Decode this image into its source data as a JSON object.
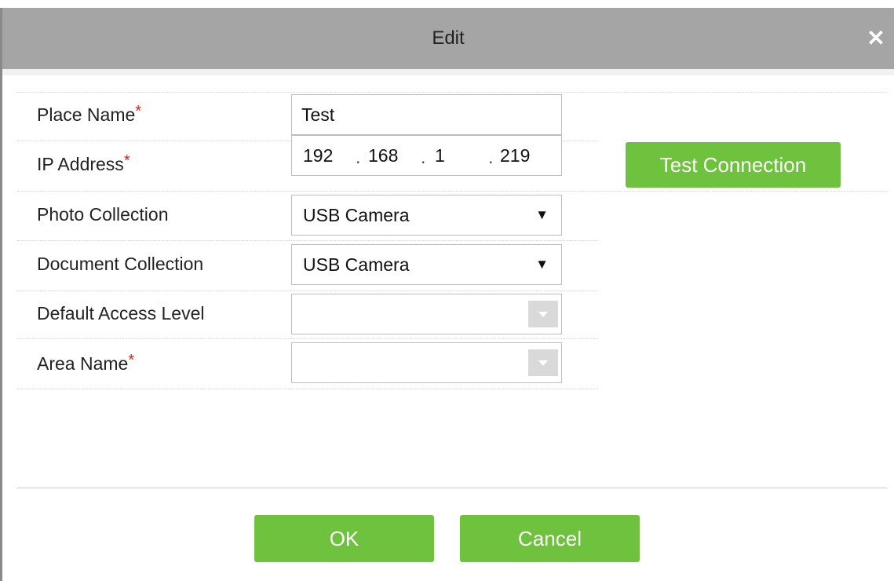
{
  "dialog": {
    "title": "Edit",
    "close_label": "✕"
  },
  "form": {
    "place_name": {
      "label": "Place Name",
      "required_mark": "*",
      "value": "Test"
    },
    "ip_address": {
      "label": "IP Address",
      "required_mark": "*",
      "octets": [
        "192",
        "168",
        "1",
        "219"
      ],
      "separator": "."
    },
    "photo_collection": {
      "label": "Photo Collection",
      "selected": "USB Camera",
      "arrow": "▼"
    },
    "document_collection": {
      "label": "Document Collection",
      "selected": "USB Camera",
      "arrow": "▼"
    },
    "default_access_level": {
      "label": "Default Access Level",
      "value": ""
    },
    "area_name": {
      "label": "Area Name",
      "required_mark": "*",
      "value": ""
    }
  },
  "buttons": {
    "test_connection": "Test Connection",
    "ok": "OK",
    "cancel": "Cancel"
  },
  "colors": {
    "titlebar": "#a5a5a5",
    "button_green": "#6ec23e",
    "required": "#e02020"
  }
}
